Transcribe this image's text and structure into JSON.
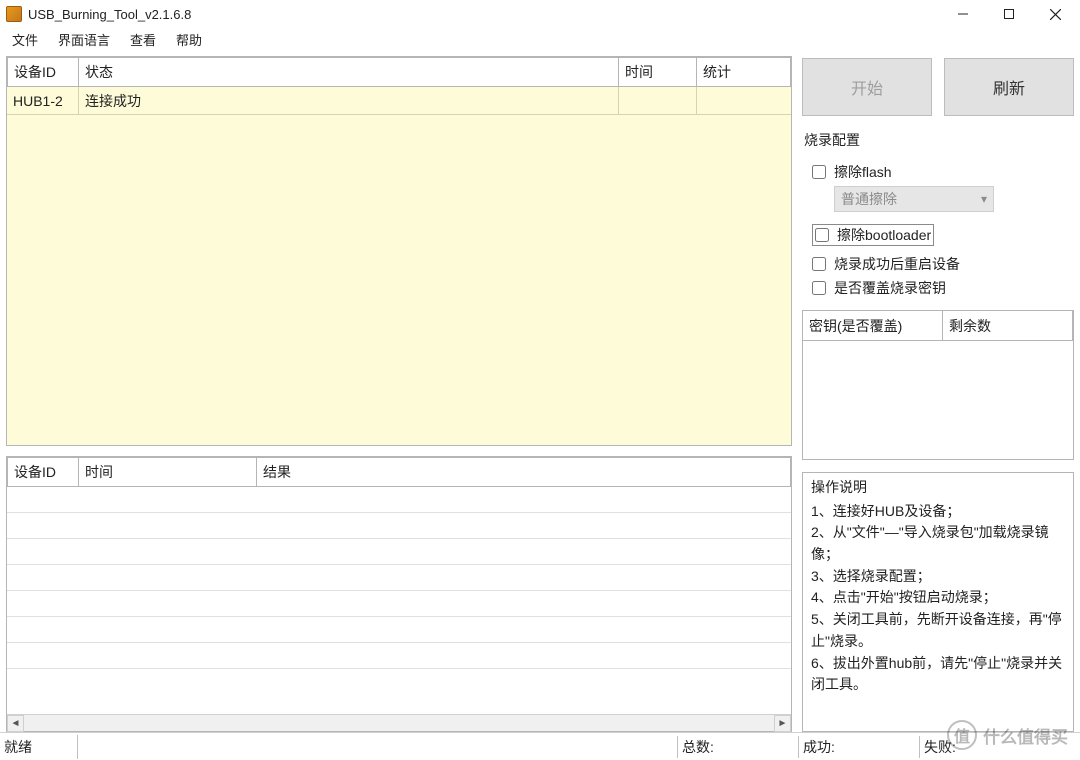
{
  "window": {
    "title": "USB_Burning_Tool_v2.1.6.8"
  },
  "menu": {
    "file": "文件",
    "lang": "界面语言",
    "view": "查看",
    "help": "帮助"
  },
  "device_table": {
    "headers": {
      "id": "设备ID",
      "state": "状态",
      "time": "时间",
      "stat": "统计"
    },
    "rows": [
      {
        "id": "HUB1-2",
        "state": "连接成功",
        "time": "",
        "stat": ""
      }
    ]
  },
  "result_table": {
    "headers": {
      "id": "设备ID",
      "time": "时间",
      "result": "结果"
    }
  },
  "buttons": {
    "start": "开始",
    "refresh": "刷新"
  },
  "config": {
    "title": "烧录配置",
    "erase_flash": "擦除flash",
    "erase_mode": "普通擦除",
    "erase_bootloader": "擦除bootloader",
    "reboot_after": "烧录成功后重启设备",
    "overwrite_key": "是否覆盖烧录密钥"
  },
  "key_table": {
    "headers": {
      "key": "密钥(是否覆盖)",
      "remain": "剩余数"
    }
  },
  "instructions": {
    "title": "操作说明",
    "i1": "1、连接好HUB及设备；",
    "i2": "2、从\"文件\"—\"导入烧录包\"加载烧录镜像；",
    "i3": "3、选择烧录配置；",
    "i4": "4、点击\"开始\"按钮启动烧录；",
    "i5": "5、关闭工具前，先断开设备连接，再\"停止\"烧录。",
    "i6": "6、拔出外置hub前，请先\"停止\"烧录并关闭工具。"
  },
  "status": {
    "ready": "就绪",
    "total": "总数:",
    "success": "成功:",
    "fail": "失败:"
  },
  "watermark": {
    "badge": "值",
    "text": "什么值得买"
  }
}
